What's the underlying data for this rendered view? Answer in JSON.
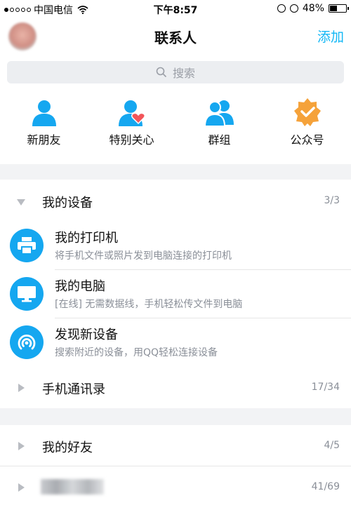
{
  "status_bar": {
    "carrier": "中国电信",
    "time": "下午8:57",
    "battery": "48%",
    "battery_level": 0.48,
    "signal_bars_on": 1,
    "signal_bars_total": 5
  },
  "header": {
    "title": "联系人",
    "add_label": "添加"
  },
  "search": {
    "placeholder": "搜索"
  },
  "quick_entries": [
    {
      "label": "新朋友",
      "icon": "person-icon"
    },
    {
      "label": "特别关心",
      "icon": "person-heart-icon"
    },
    {
      "label": "群组",
      "icon": "group-icon"
    },
    {
      "label": "公众号",
      "icon": "verified-badge-icon"
    }
  ],
  "groups": {
    "devices": {
      "name": "我的设备",
      "count": "3/3",
      "expanded": true
    },
    "phone_contacts": {
      "name": "手机通讯录",
      "count": "17/34"
    },
    "friends": {
      "name": "我的好友",
      "count": "4/5"
    },
    "hidden_group": {
      "count": "41/69"
    }
  },
  "devices": [
    {
      "title": "我的打印机",
      "subtitle": "将手机文件或照片发到电脑连接的打印机",
      "icon": "printer-icon"
    },
    {
      "title": "我的电脑",
      "subtitle": "[在线] 无需数据线，手机轻松传文件到电脑",
      "icon": "monitor-icon"
    },
    {
      "title": "发现新设备",
      "subtitle": "搜索附近的设备，用QQ轻松连接设备",
      "icon": "radar-icon"
    }
  ],
  "colors": {
    "accent": "#12b7f5",
    "device_icon_bg": "#15a7f0",
    "badge_orange": "#f5a23a",
    "heart_red": "#f2555a",
    "section_gap": "#f2f3f5"
  }
}
